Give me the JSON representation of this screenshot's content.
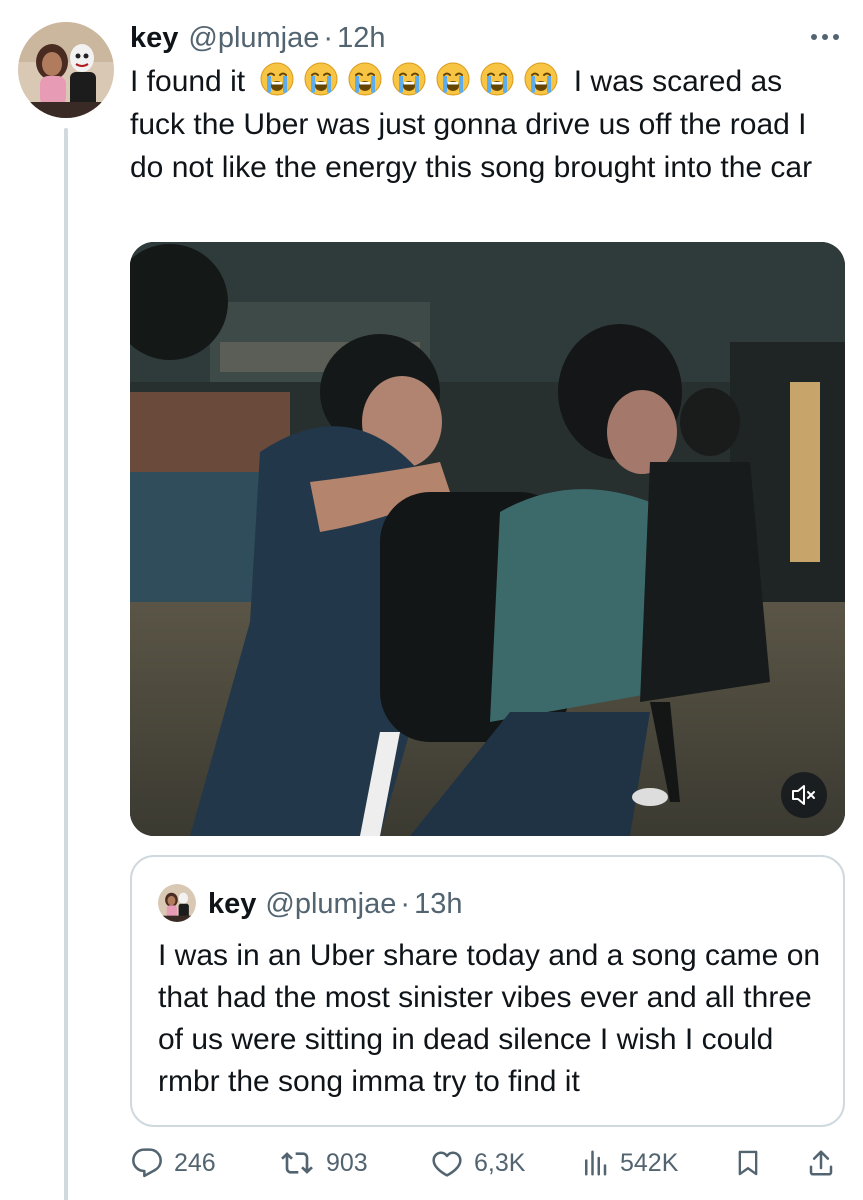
{
  "tweet": {
    "author_name": "key",
    "author_handle": "@plumjae",
    "separator": "·",
    "time": "12h",
    "text_before_emoji": "I found it",
    "emoji_icons": [
      "loudly-crying-face-icon",
      "loudly-crying-face-icon",
      "loudly-crying-face-icon",
      "loudly-crying-face-icon",
      "loudly-crying-face-icon",
      "loudly-crying-face-icon",
      "loudly-crying-face-icon"
    ],
    "text_after_emoji": "I was scared as fuck the Uber was just gonna drive us off the road I do not like the energy this song brought into the car",
    "media": {
      "type": "video",
      "muted_icon": "speaker-muted-icon"
    }
  },
  "quoted_tweet": {
    "author_name": "key",
    "author_handle": "@plumjae",
    "separator": "·",
    "time": "13h",
    "text": "I was in an Uber share today and a song came on that had the most sinister vibes ever and all three of us were sitting in dead silence I wish I could rmbr the song imma try to find it"
  },
  "actions": {
    "replies": "246",
    "reposts": "903",
    "likes": "6,3K",
    "views": "542K",
    "bookmark_icon": "bookmark-icon",
    "share_icon": "share-icon"
  },
  "colors": {
    "text": "#0f1419",
    "secondary": "#536471",
    "border": "#cfd9de"
  }
}
